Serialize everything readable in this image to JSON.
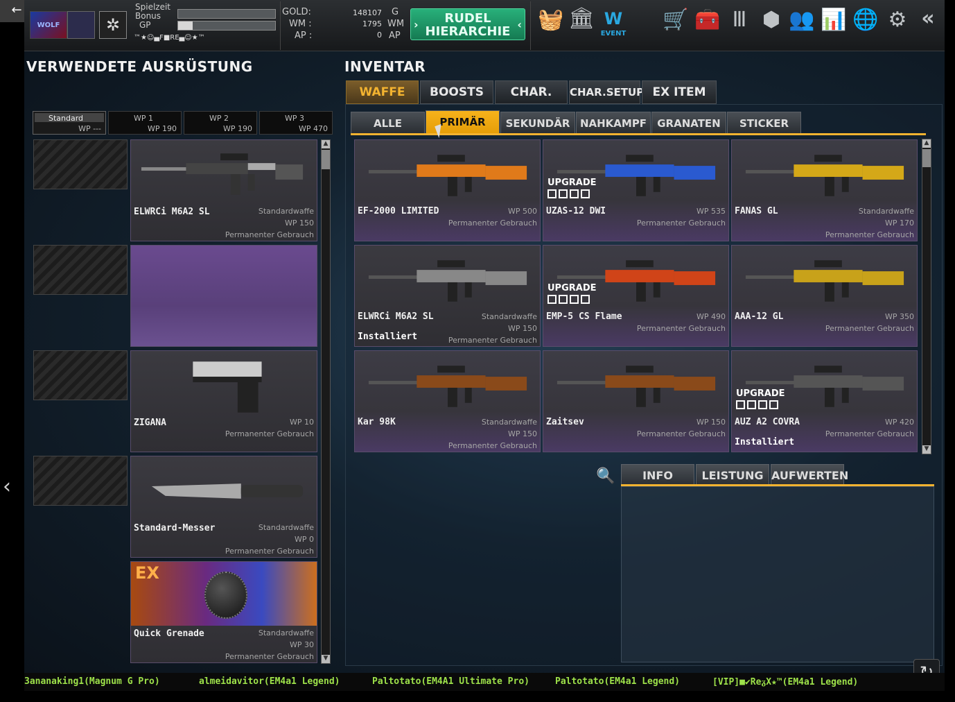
{
  "topbar": {
    "stat_labels": [
      "Spielzeit",
      "Bonus",
      "GP"
    ],
    "clan_tag": "™★☺▄F■RE▄☺★™",
    "gold_label": "GOLD:",
    "gold_value": "148107",
    "gold_unit": "G",
    "wm_label": "WM :",
    "wm_value": "1795",
    "wm_unit": "WM",
    "ap_label": "AP :",
    "ap_value": "0",
    "ap_unit": "AP",
    "rudel_line1": "RUDEL",
    "rudel_line2": "HIERARCHIE",
    "event_label": "EVENT",
    "bonus_progress": 0.15,
    "spielzeit_progress": 0.0,
    "gp_progress": 0.0
  },
  "left": {
    "title": "VERWENDETE AUSRÜSTUNG",
    "wp_tabs": [
      {
        "label": "Standard",
        "value": "WP ---"
      },
      {
        "label": "WP 1",
        "value": "WP 190"
      },
      {
        "label": "WP 2",
        "value": "WP 190"
      },
      {
        "label": "WP 3",
        "value": "WP 470"
      }
    ],
    "slots": [
      {
        "name": "ELWRCi M6A2 SL",
        "line1": "Standardwaffe",
        "line2": "WP 150",
        "line3": "Permanenter Gebrauch",
        "icon": "rifle-icon"
      },
      {
        "name": "",
        "line1": "",
        "line2": "",
        "line3": "",
        "icon": ""
      },
      {
        "name": "ZIGANA",
        "line1": "",
        "line2": "WP 10",
        "line3": "Permanenter Gebrauch",
        "icon": "pistol-icon"
      },
      {
        "name": "Standard-Messer",
        "line1": "Standardwaffe",
        "line2": "WP 0",
        "line3": "Permanenter Gebrauch",
        "icon": "knife-icon"
      },
      {
        "name": "Quick Grenade",
        "line1": "Standardwaffe",
        "line2": "WP 30",
        "line3": "Permanenter Gebrauch",
        "icon": "grenade-icon",
        "badge": "EX"
      }
    ]
  },
  "inventory": {
    "title": "INVENTAR",
    "main_tabs": [
      "WAFFE",
      "BOOSTS",
      "CHAR.",
      "CHAR.SETUP",
      "EX ITEM"
    ],
    "sub_tabs": [
      "ALLE",
      "PRIMÄR",
      "SEKUNDÄR",
      "NAHKAMPF",
      "GRANATEN",
      "STICKER"
    ],
    "upgrade_label": "UPGRADE",
    "installed_label": "Installiert",
    "items": [
      {
        "name": "EF-2000 LIMITED",
        "line1": "",
        "line2": "WP 500",
        "line3": "Permanenter Gebrauch",
        "upgrade": false,
        "installed": false,
        "icon": "bullpup-rifle-icon"
      },
      {
        "name": "UZAS-12 DWI",
        "line1": "",
        "line2": "WP 535",
        "line3": "Permanenter Gebrauch",
        "upgrade": true,
        "installed": false,
        "icon": "shotgun-icon"
      },
      {
        "name": "FANAS GL",
        "line1": "Standardwaffe",
        "line2": "WP 170",
        "line3": "Permanenter Gebrauch",
        "upgrade": false,
        "installed": false,
        "icon": "gold-rifle-icon"
      },
      {
        "name": "ELWRCi M6A2 SL",
        "line1": "Standardwaffe",
        "line2": "WP 150",
        "line3": "Permanenter Gebrauch",
        "upgrade": false,
        "installed": true,
        "icon": "rifle-icon"
      },
      {
        "name": "EMP-5 CS Flame",
        "line1": "",
        "line2": "WP 490",
        "line3": "Permanenter Gebrauch",
        "upgrade": true,
        "installed": false,
        "icon": "smg-icon"
      },
      {
        "name": "AAA-12 GL",
        "line1": "",
        "line2": "WP 350",
        "line3": "Permanenter Gebrauch",
        "upgrade": false,
        "installed": false,
        "icon": "gold-shotgun-icon"
      },
      {
        "name": "Kar 98K",
        "line1": "Standardwaffe",
        "line2": "WP 150",
        "line3": "Permanenter Gebrauch",
        "upgrade": false,
        "installed": false,
        "icon": "sniper-icon"
      },
      {
        "name": "Zaitsev",
        "line1": "",
        "line2": "WP 150",
        "line3": "Permanenter Gebrauch",
        "upgrade": false,
        "installed": false,
        "icon": "sniper-icon"
      },
      {
        "name": "AUZ A2 COVRA",
        "line1": "",
        "line2": "WP 420",
        "line3": "Permanenter Gebrauch",
        "upgrade": true,
        "installed": true,
        "icon": "bullpup-rifle-icon"
      }
    ],
    "info_tabs": [
      "INFO",
      "LEISTUNG",
      "AUFWERTEN"
    ]
  },
  "ticker": [
    "3ananaking1(Magnum G Pro)",
    "almeidavitor(EM4a1 Legend)",
    "Paltotato(EM4A1 Ultimate Pro)",
    "Paltotato(EM4a1 Legend)",
    "[VIP]■✔ReᵹX★™(EM4a1 Legend)"
  ],
  "colors": {
    "accent": "#f3b330",
    "ticker": "#9ee24a",
    "rudel": "#1f9c6b"
  }
}
